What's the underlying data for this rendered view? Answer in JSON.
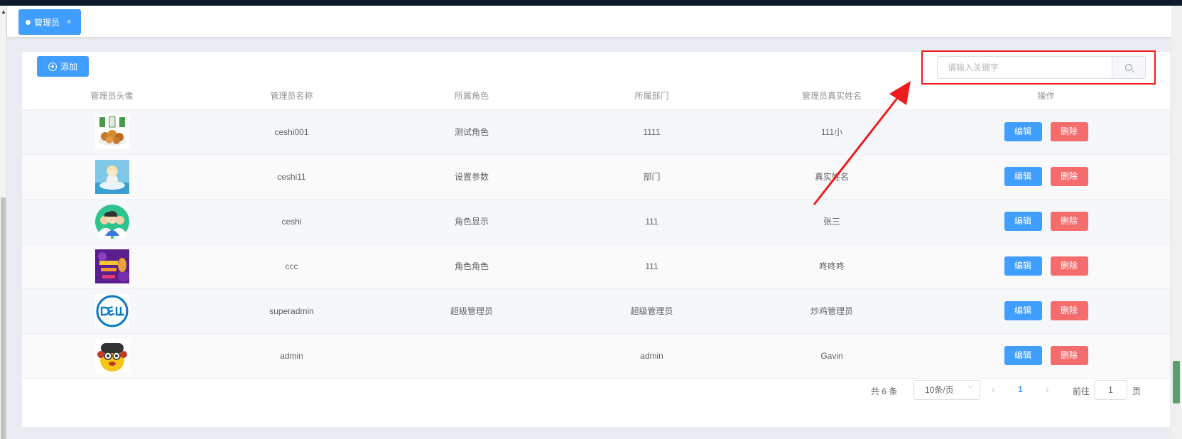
{
  "tab": {
    "label": "管理员",
    "close": "×"
  },
  "toolbar": {
    "add_label": "添加"
  },
  "search": {
    "placeholder": "请输入关键字"
  },
  "table": {
    "headers": [
      "管理员头像",
      "管理员名称",
      "所属角色",
      "所属部门",
      "管理员真实姓名",
      "操作"
    ],
    "rows": [
      {
        "name": "ceshi001",
        "role": "测试角色",
        "dept": "1111",
        "real_name": "111小"
      },
      {
        "name": "ceshi11",
        "role": "设置参数",
        "dept": "部门",
        "real_name": "真实姓名"
      },
      {
        "name": "ceshi",
        "role": "角色显示",
        "dept": "111",
        "real_name": "张三"
      },
      {
        "name": "ccc",
        "role": "角色角色",
        "dept": "111",
        "real_name": "咚咚咚"
      },
      {
        "name": "superadmin",
        "role": "超级管理员",
        "dept": "超级管理员",
        "real_name": "炒鸡管理员"
      },
      {
        "name": "admin",
        "role": "",
        "dept": "admin",
        "real_name": "Gavin"
      }
    ],
    "edit_label": "编辑",
    "delete_label": "删除"
  },
  "pagination": {
    "total": "共 6 条",
    "page_size": "10条/页",
    "current": "1",
    "goto": "前往",
    "jump_value": "1",
    "page_unit": "页"
  },
  "colors": {
    "primary": "#409eff",
    "danger": "#f56c6c",
    "annotation": "#ee1c1c"
  }
}
